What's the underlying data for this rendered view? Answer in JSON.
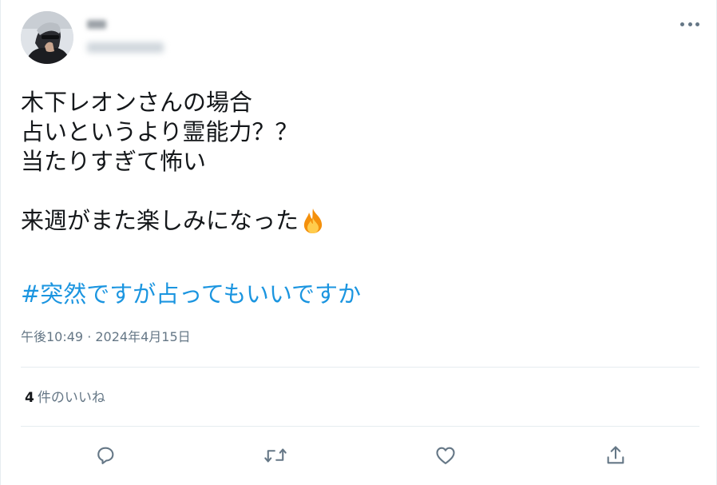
{
  "tweet": {
    "body_lines": [
      "木下レオンさんの場合",
      "占いというより霊能力？？",
      "当たりすぎて怖い",
      "",
      "来週がまた楽しみになった"
    ],
    "emoji": "fire-emoji",
    "hashtag": "#突然ですが占ってもいいですか",
    "timestamp": "午後10:49 · 2024年4月15日",
    "likes_count": "4",
    "likes_label": "件のいいね"
  },
  "icons": {
    "more": "more-horizontal-icon",
    "reply": "reply-icon",
    "retweet": "retweet-icon",
    "like": "heart-icon",
    "share": "share-icon"
  },
  "colors": {
    "text": "#14171a",
    "secondary": "#657786",
    "link": "#1b95e0",
    "border": "#e6ecf0"
  }
}
